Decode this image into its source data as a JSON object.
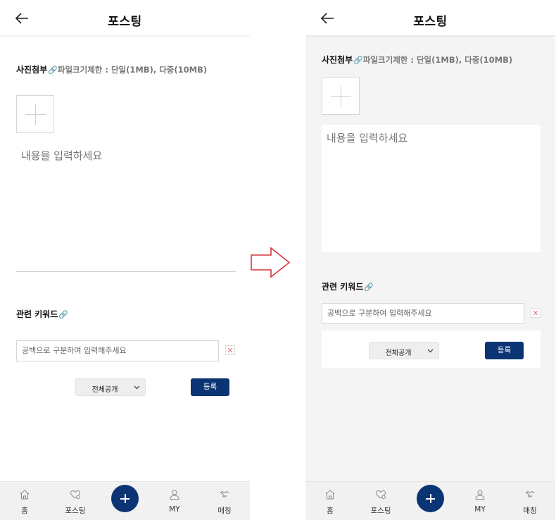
{
  "left_screen": {
    "header": {
      "title": "포스팅"
    },
    "photo_section": {
      "label": "사진첨부",
      "clip": "🔗",
      "limit": "파일크기제한 : 단일(1MB), 다중(10MB)"
    },
    "content": {
      "placeholder": "내용을 입력하세요"
    },
    "keyword_section": {
      "label": "관련 키워드",
      "clip": "🔗"
    },
    "keyword_input": {
      "placeholder": "공백으로 구분하여 입력해주세요"
    },
    "visibility": {
      "selected": "전체공개"
    },
    "submit": {
      "label": "등록"
    }
  },
  "right_screen": {
    "header": {
      "title": "포스팅"
    },
    "photo_section": {
      "label": "사진첨부",
      "clip": "🔗",
      "limit": "파일크기제한 : 단일(1MB), 다중(10MB)"
    },
    "content": {
      "placeholder": "내용을 입력하세요"
    },
    "keyword_section": {
      "label": "관련 키워드",
      "clip": "🔗"
    },
    "keyword_input": {
      "placeholder": "공백으로 구분하여 입력해주세요"
    },
    "visibility": {
      "selected": "전체공개"
    },
    "submit": {
      "label": "등록"
    }
  },
  "tabbar": {
    "items": [
      {
        "label": "홈",
        "icon": "home-icon"
      },
      {
        "label": "포스팅",
        "icon": "posting-heart-icon"
      },
      {
        "label": "",
        "icon": "add-icon"
      },
      {
        "label": "MY",
        "icon": "user-icon"
      },
      {
        "label": "매칭",
        "icon": "handshake-icon"
      }
    ]
  },
  "colors": {
    "primary": "#0b3474",
    "arrow": "#d9363e",
    "right_background": "#f4f4f4"
  }
}
